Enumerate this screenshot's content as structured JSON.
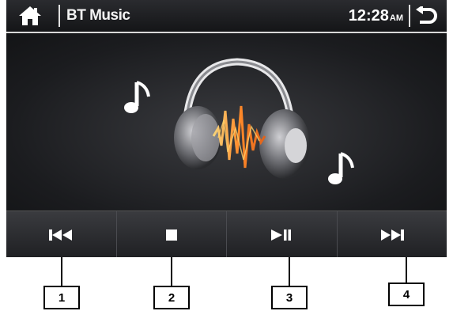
{
  "window": {
    "title": "BT Music"
  },
  "status": {
    "time": "12:28",
    "ampm": "AM"
  },
  "icons": {
    "home": "home-icon",
    "back": "back-arrow-icon",
    "artwork": "headphones-music-icon",
    "notes": "music-note-icon"
  },
  "controls": [
    {
      "name": "previous-track-button",
      "icon": "previous-icon"
    },
    {
      "name": "stop-button",
      "icon": "stop-icon"
    },
    {
      "name": "play-pause-button",
      "icon": "play-pause-icon"
    },
    {
      "name": "next-track-button",
      "icon": "next-icon"
    }
  ],
  "callouts": [
    "1",
    "2",
    "3",
    "4"
  ]
}
